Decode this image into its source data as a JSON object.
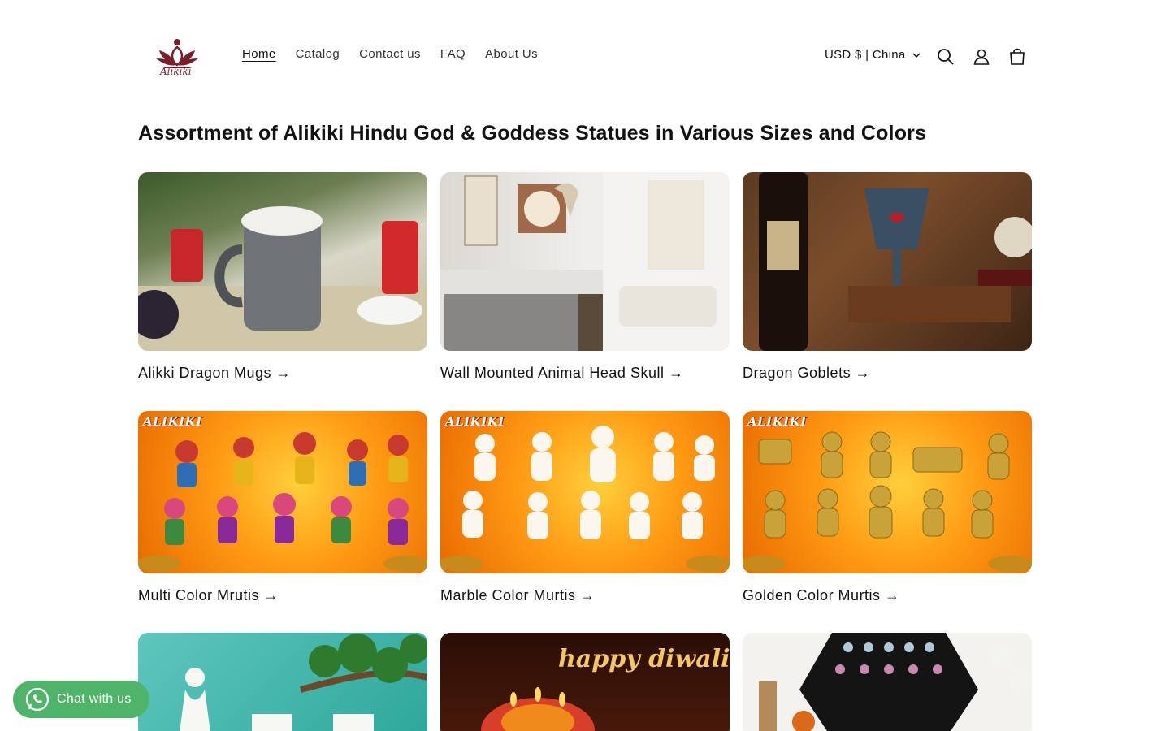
{
  "brand": {
    "logo_text": "Alikiki"
  },
  "nav": {
    "items": [
      {
        "label": "Home",
        "active": true
      },
      {
        "label": "Catalog"
      },
      {
        "label": "Contact us"
      },
      {
        "label": "FAQ"
      },
      {
        "label": "About Us"
      }
    ]
  },
  "header": {
    "locale": "USD $ | China",
    "icons": [
      "search-icon",
      "account-icon",
      "cart-icon"
    ]
  },
  "main": {
    "heading": "Assortment of Alikiki Hindu God & Goddess Statues in Various Sizes and Colors",
    "collections": [
      {
        "title": "Alikki Dragon Mugs →"
      },
      {
        "title": "Wall Mounted Animal Head Skull →"
      },
      {
        "title": "Dragon Goblets →"
      },
      {
        "title": "Multi Color Mrutis →",
        "image_text": "ALIKIKI"
      },
      {
        "title": "Marble Color Murtis →",
        "image_text": "ALIKIKI"
      },
      {
        "title": "Golden Color Murtis →",
        "image_text": "ALIKIKI"
      },
      {
        "title": ""
      },
      {
        "title": "",
        "image_text": "happy diwali"
      },
      {
        "title": ""
      }
    ]
  },
  "chat": {
    "label": "Chat with us"
  },
  "colors": {
    "chat_green": "#4fb36a",
    "logo_maroon": "#7a1f2a"
  }
}
